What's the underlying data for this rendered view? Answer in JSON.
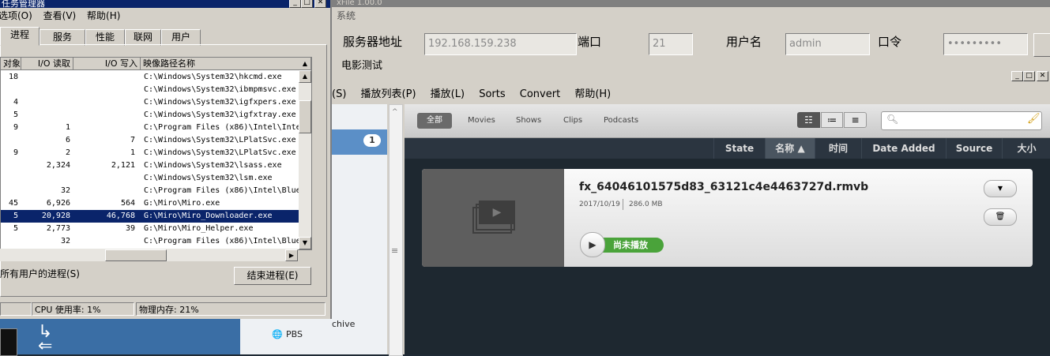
{
  "taskmgr": {
    "title": "任务管理器",
    "menu": [
      "选项(O)",
      "查看(V)",
      "帮助(H)"
    ],
    "tabs": [
      "进程",
      "服务",
      "性能",
      "联网",
      "用户"
    ],
    "columns": [
      "对象",
      "I/O 读取",
      "I/O 写入",
      "映像路径名称"
    ],
    "rows": [
      {
        "obj": "18",
        "read": "",
        "write": "",
        "path": "C:\\Windows\\System32\\hkcmd.exe"
      },
      {
        "obj": "",
        "read": "",
        "write": "",
        "path": "C:\\Windows\\System32\\ibmpmsvc.exe"
      },
      {
        "obj": "4",
        "read": "",
        "write": "",
        "path": "C:\\Windows\\System32\\igfxpers.exe"
      },
      {
        "obj": "5",
        "read": "",
        "write": "",
        "path": "C:\\Windows\\System32\\igfxtray.exe"
      },
      {
        "obj": "9",
        "read": "1",
        "write": "",
        "path": "C:\\Program Files (x86)\\Intel\\Inte"
      },
      {
        "obj": "",
        "read": "6",
        "write": "7",
        "path": "C:\\Windows\\System32\\LPlatSvc.exe"
      },
      {
        "obj": "9",
        "read": "2",
        "write": "1",
        "path": "C:\\Windows\\System32\\LPlatSvc.exe"
      },
      {
        "obj": "",
        "read": "2,324",
        "write": "2,121",
        "path": "C:\\Windows\\System32\\lsass.exe"
      },
      {
        "obj": "",
        "read": "",
        "write": "",
        "path": "C:\\Windows\\System32\\lsm.exe"
      },
      {
        "obj": "",
        "read": "32",
        "write": "",
        "path": "C:\\Program Files (x86)\\Intel\\Blue"
      },
      {
        "obj": "45",
        "read": "6,926",
        "write": "564",
        "path": "G:\\Miro\\Miro.exe"
      },
      {
        "obj": "5",
        "read": "20,928",
        "write": "46,768",
        "path": "G:\\Miro\\Miro_Downloader.exe",
        "selected": true
      },
      {
        "obj": "5",
        "read": "2,773",
        "write": "39",
        "path": "G:\\Miro\\Miro_Helper.exe"
      },
      {
        "obj": "",
        "read": "32",
        "write": "",
        "path": "C:\\Program Files (x86)\\Intel\\Blue"
      }
    ],
    "show_all_users": "所有用户的进程(S)",
    "end_process": "结束进程(E)",
    "status": {
      "blank": "",
      "cpu": "CPU 使用率: 1%",
      "mem": "物理内存: 21%"
    }
  },
  "xfile": {
    "title": "xFile 1.00.0",
    "menu": "系统",
    "server_label": "服务器地址",
    "server_value": "192.168.159.238",
    "port_label": "端口",
    "port_value": "21",
    "user_label": "用户名",
    "user_value": "admin",
    "pass_label": "口令",
    "pass_value": "•••••••••",
    "tab_fragment": "电影测试"
  },
  "miro": {
    "menu": [
      "(S)",
      "播放列表(P)",
      "播放(L)",
      "Sorts",
      "Convert",
      "帮助(H)"
    ],
    "sidebar_badge": "1",
    "sidebar_items": [
      "chive",
      "PBS"
    ],
    "filters": [
      "全部",
      "Movies",
      "Shows",
      "Clips",
      "Podcasts"
    ],
    "columns": [
      "State",
      "名称 ▲",
      "时间",
      "Date Added",
      "Source",
      "大小"
    ],
    "item": {
      "title": "fx_64046101575d83_63121c4e4463727d.rmvb",
      "date": "2017/10/19",
      "size": "286.0 MB",
      "status": "尚未播放"
    }
  }
}
